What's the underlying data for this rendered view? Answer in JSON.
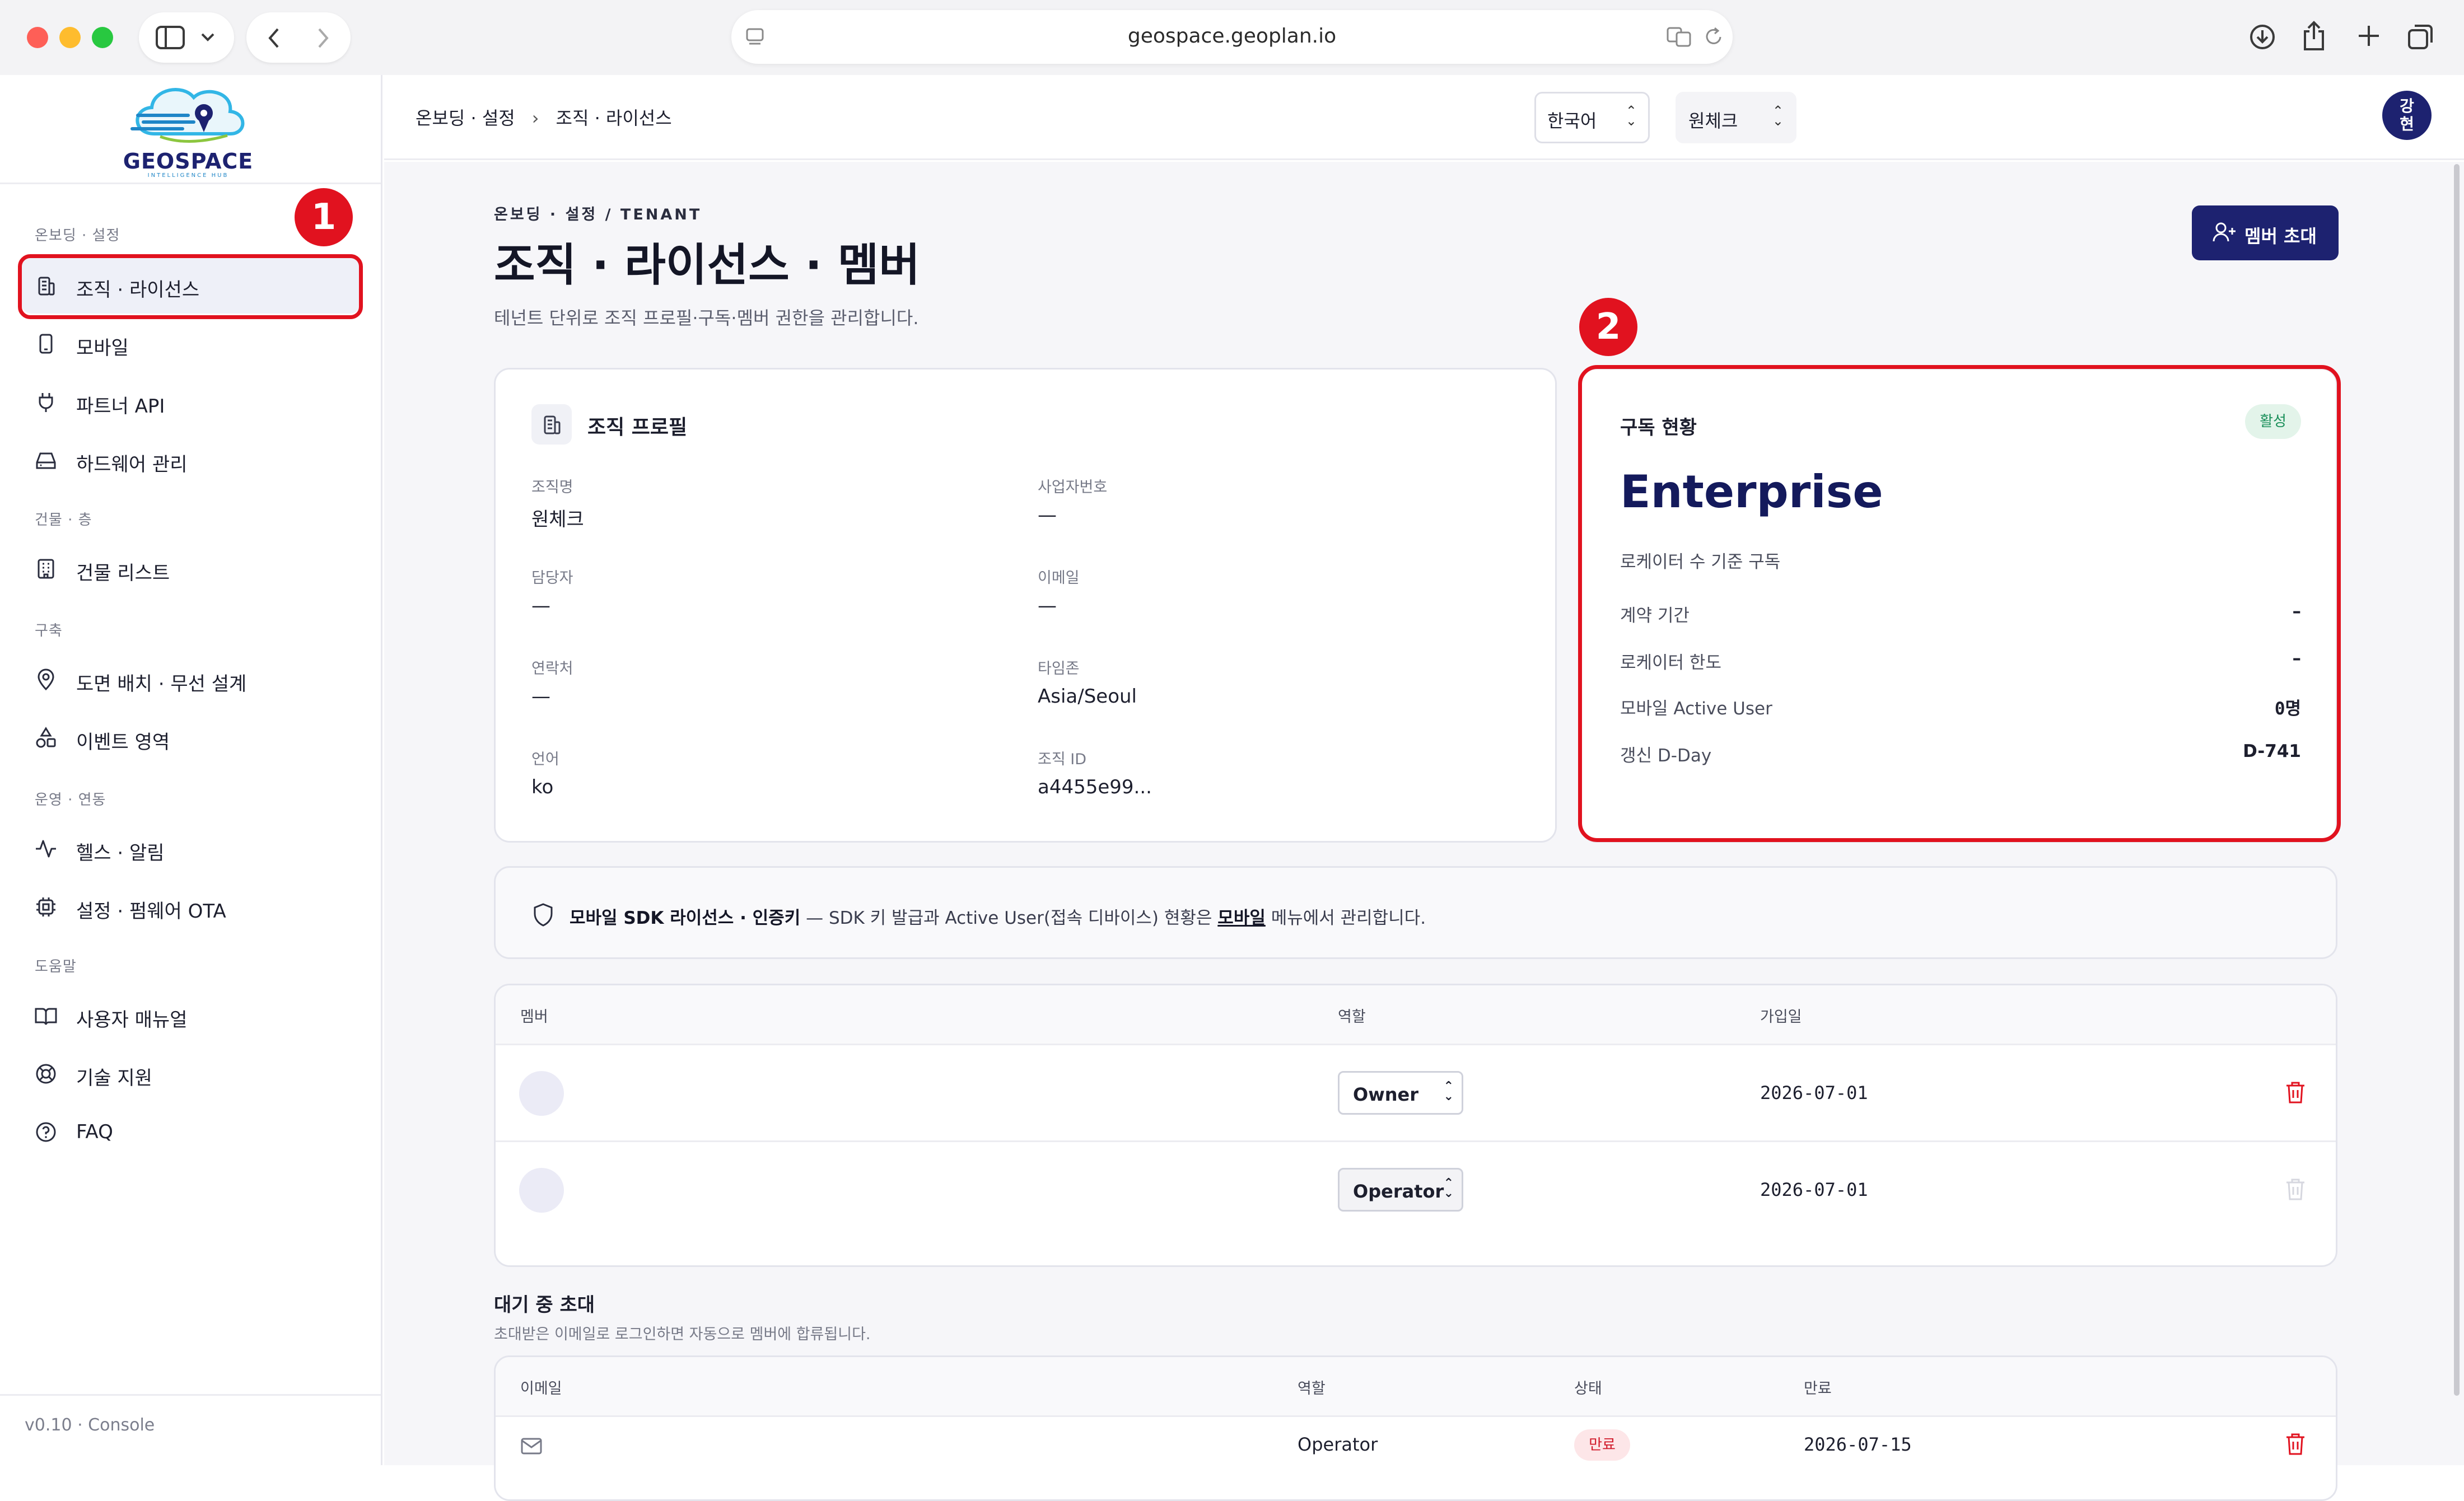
{
  "browser": {
    "url": "geospace.geoplan.io"
  },
  "logo": {
    "wordmark": "GEOSPACE",
    "tagline": "INTELLIGENCE HUB"
  },
  "sidebar": {
    "sections": [
      {
        "title": "온보딩 · 설정",
        "items": [
          {
            "label": "조직 · 라이선스",
            "icon": "building-icon",
            "active": true
          },
          {
            "label": "모바일",
            "icon": "mobile-icon"
          },
          {
            "label": "파트너 API",
            "icon": "plug-icon"
          },
          {
            "label": "하드웨어 관리",
            "icon": "hard-drive-icon"
          }
        ]
      },
      {
        "title": "건물 · 층",
        "items": [
          {
            "label": "건물 리스트",
            "icon": "building-list-icon"
          }
        ]
      },
      {
        "title": "구축",
        "items": [
          {
            "label": "도면 배치 · 무선 설계",
            "icon": "map-pin-icon"
          },
          {
            "label": "이벤트 영역",
            "icon": "shapes-icon"
          }
        ]
      },
      {
        "title": "운영 · 연동",
        "items": [
          {
            "label": "헬스 · 알림",
            "icon": "activity-icon"
          },
          {
            "label": "설정 · 펌웨어 OTA",
            "icon": "chip-icon"
          }
        ]
      },
      {
        "title": "도움말",
        "items": [
          {
            "label": "사용자 매뉴얼",
            "icon": "book-icon"
          },
          {
            "label": "기술 지원",
            "icon": "lifebuoy-icon"
          },
          {
            "label": "FAQ",
            "icon": "help-circle-icon"
          }
        ]
      }
    ],
    "version": "v0.10 · Console"
  },
  "markers": {
    "one": "1",
    "two": "2"
  },
  "topbar": {
    "breadcrumb": [
      "온보딩 · 설정",
      "조직 · 라이선스"
    ],
    "breadcrumb_sep": "›",
    "language": "한국어",
    "org": "원체크",
    "avatar": "강\n현"
  },
  "page": {
    "eyebrow": "온보딩 · 설정 / TENANT",
    "title": "조직 · 라이선스 · 멤버",
    "subtitle": "테넌트 단위로 조직 프로필·구독·멤버 권한을 관리합니다.",
    "invite_button": "멤버 초대"
  },
  "profile": {
    "title": "조직 프로필",
    "fields": [
      {
        "label": "조직명",
        "value": "원체크"
      },
      {
        "label": "사업자번호",
        "value": "—"
      },
      {
        "label": "담당자",
        "value": "—"
      },
      {
        "label": "이메일",
        "value": "—"
      },
      {
        "label": "연락처",
        "value": "—"
      },
      {
        "label": "타임존",
        "value": "Asia/Seoul"
      },
      {
        "label": "언어",
        "value": "ko"
      },
      {
        "label": "조직 ID",
        "value": "a4455e99..."
      }
    ]
  },
  "subscription": {
    "title": "구독 현황",
    "status": "활성",
    "plan": "Enterprise",
    "plan_desc": "로케이터 수 기준 구독",
    "rows": [
      {
        "label": "계약 기간",
        "value": "–"
      },
      {
        "label": "로케이터 한도",
        "value": "–"
      },
      {
        "label": "모바일 Active User",
        "value": "0명"
      },
      {
        "label": "갱신 D-Day",
        "value": "D-741"
      }
    ],
    "status_color": "#1a8f5a"
  },
  "sdk_notice": {
    "strong": "모바일 SDK 라이선스 · 인증키",
    "text": " — SDK 키 발급과 Active User(접속 디바이스) 현황은 ",
    "link": "모바일",
    "tail": " 메뉴에서 관리합니다."
  },
  "members": {
    "headers": [
      "멤버",
      "역할",
      "가입일"
    ],
    "rows": [
      {
        "role": "Owner",
        "joined": "2026-07-01",
        "deletable": true
      },
      {
        "role": "Operator",
        "joined": "2026-07-01",
        "deletable": false
      }
    ]
  },
  "pending": {
    "title": "대기 중 초대",
    "subtitle": "초대받은 이메일로 로그인하면 자동으로 멤버에 합류됩니다.",
    "headers": [
      "이메일",
      "역할",
      "상태",
      "만료"
    ],
    "rows": [
      {
        "role": "Operator",
        "status": "만료",
        "expires": "2026-07-15"
      }
    ]
  },
  "colors": {
    "accent": "#1d2270",
    "danger": "#e1121f",
    "active_green": "#1a8f5a"
  }
}
